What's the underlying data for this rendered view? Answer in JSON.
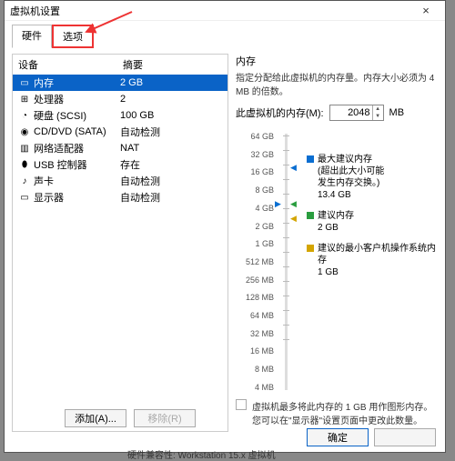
{
  "window": {
    "title": "虚拟机设置",
    "close": "×"
  },
  "tabs": {
    "hardware": "硬件",
    "options": "选项"
  },
  "hw": {
    "header_device": "设备",
    "header_summary": "摘要",
    "rows": [
      {
        "icon": "▭",
        "name": "内存",
        "summary": "2 GB",
        "selected": true
      },
      {
        "icon": "⊞",
        "name": "处理器",
        "summary": "2"
      },
      {
        "icon": "◔",
        "name": "硬盘 (SCSI)",
        "summary": "100 GB"
      },
      {
        "icon": "◉",
        "name": "CD/DVD (SATA)",
        "summary": "自动检测"
      },
      {
        "icon": "▥",
        "name": "网络适配器",
        "summary": "NAT"
      },
      {
        "icon": "⬮",
        "name": "USB 控制器",
        "summary": "存在"
      },
      {
        "icon": "♪",
        "name": "声卡",
        "summary": "自动检测"
      },
      {
        "icon": "▭",
        "name": "显示器",
        "summary": "自动检测"
      }
    ]
  },
  "memory": {
    "group_title": "内存",
    "group_desc": "指定分配给此虚拟机的内存量。内存大小必须为 4 MB 的倍数。",
    "label": "此虚拟机的内存(M):",
    "value": "2048",
    "unit": "MB",
    "ticks": [
      "64 GB",
      "32 GB",
      "16 GB",
      "8 GB",
      "4 GB",
      "2 GB",
      "1 GB",
      "512 MB",
      "256 MB",
      "128 MB",
      "64 MB",
      "32 MB",
      "16 MB",
      "8 MB",
      "4 MB"
    ],
    "legend": {
      "max": {
        "title": "最大建议内存",
        "note1": "(超出此大小可能",
        "note2": "发生内存交换。)",
        "value": "13.4 GB",
        "color": "#0a6ed1"
      },
      "rec": {
        "title": "建议内存",
        "value": "2 GB",
        "color": "#2a9d3f"
      },
      "min": {
        "title": "建议的最小客户机操作系统内存",
        "value": "1 GB",
        "color": "#d4a500"
      }
    },
    "footnote": "虚拟机最多将此内存的 1 GB 用作图形内存。您可以在\"显示器\"设置页面中更改此数量。"
  },
  "buttons": {
    "add": "添加(A)...",
    "remove": "移除(R)",
    "ok": "确定",
    "cancel": ""
  },
  "status": "硬件兼容性: Workstation 15.x 虚拟机"
}
